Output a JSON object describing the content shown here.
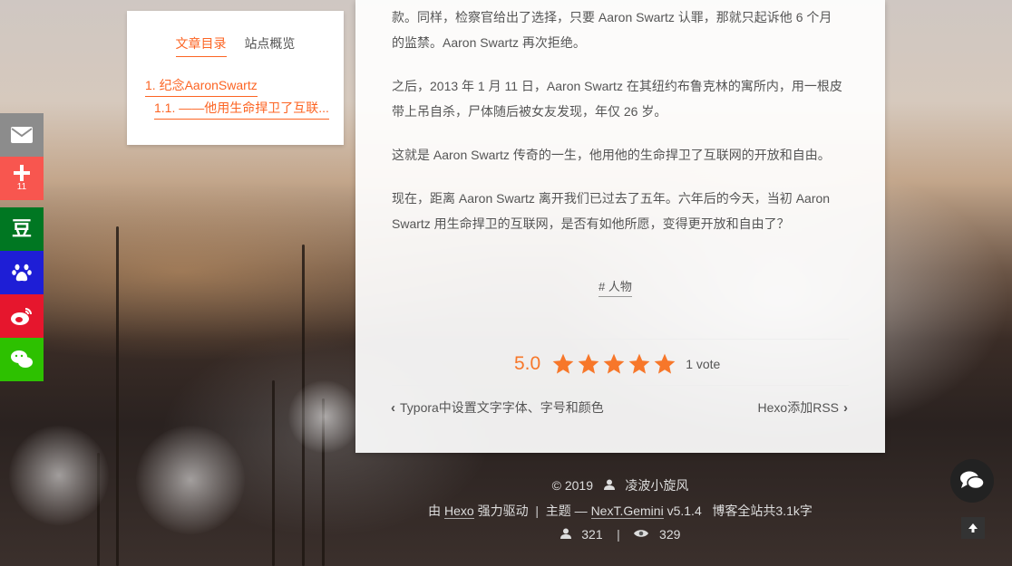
{
  "toc": {
    "tabs": [
      {
        "label": "文章目录",
        "active": true
      },
      {
        "label": "站点概览",
        "active": false
      }
    ],
    "items": [
      {
        "number": "1.",
        "text": "纪念AaronSwartz"
      },
      {
        "number": "1.1.",
        "text": "——他用生命捍卫了互联..."
      }
    ]
  },
  "share": {
    "items": [
      {
        "icon": "email-icon",
        "color": "#8c8c8c"
      },
      {
        "icon": "plus-icon",
        "color": "#f8564f",
        "count": "11"
      },
      {
        "icon": "douban-icon",
        "color": "#007722",
        "glyph": "豆"
      },
      {
        "icon": "baidu-paw-icon",
        "color": "#1e1ed6"
      },
      {
        "icon": "weibo-icon",
        "color": "#e6162d"
      },
      {
        "icon": "wechat-icon",
        "color": "#2dc100"
      }
    ]
  },
  "article": {
    "paragraphs": [
      [
        "款。同样，检察官给出了选择，只要 Aaron Swartz 认罪，那就只起诉他 6 个月",
        "的监禁。Aaron Swartz 再次拒绝。"
      ],
      [
        "之后，2013 年 1 月 11 日，Aaron Swartz 在其纽约布鲁克林的寓所内，用一根皮",
        "带上吊自杀，尸体随后被女友发现，年仅 26 岁。"
      ],
      [
        "这就是 Aaron Swartz 传奇的一生，他用他的生命捍卫了互联网的开放和自由。"
      ],
      [
        "现在，距离 Aaron Swartz 离开我们已过去了五年。六年后的今天，当初 Aaron",
        "Swartz 用生命捍卫的互联网，是否有如他所愿，变得更开放和自由了？"
      ]
    ],
    "tag": "# 人物",
    "rating": {
      "score": "5.0",
      "stars": 5,
      "votes": "1 vote",
      "color": "#f7772a"
    },
    "prev": "Typora中设置文字字体、字号和颜色",
    "next": "Hexo添加RSS"
  },
  "footer": {
    "copyright": "© 2019",
    "author": "凌波小旋风",
    "powered_prefix": "由",
    "hexo": "Hexo",
    "powered_suffix": "强力驱动",
    "sep": "|",
    "theme_prefix": "主题 —",
    "theme": "NexT.Gemini",
    "version": "v5.1.4",
    "word_count": "博客全站共3.1k字",
    "visitors": "321",
    "views": "329"
  },
  "accent": "#fc6423"
}
